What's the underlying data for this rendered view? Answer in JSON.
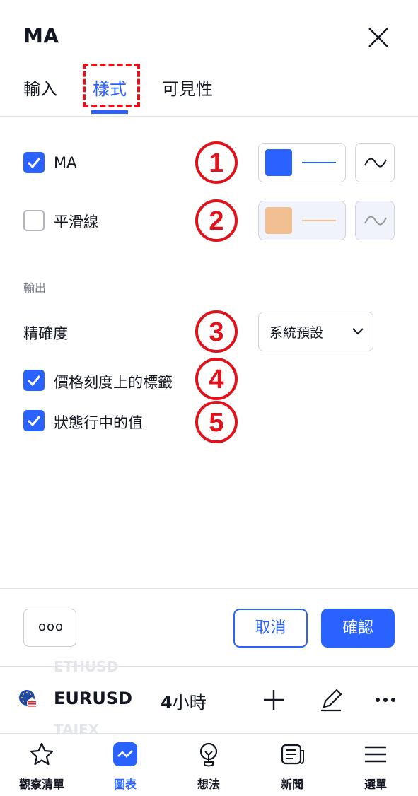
{
  "dialog": {
    "title": "MA",
    "tabs": [
      {
        "label": "輸入",
        "active": false
      },
      {
        "label": "樣式",
        "active": true
      },
      {
        "label": "可見性",
        "active": false
      }
    ]
  },
  "style_rows": [
    {
      "label": "MA",
      "checked": true,
      "color": "#2962ff",
      "callout": "①"
    },
    {
      "label": "平滑線",
      "checked": false,
      "color": "#f1bf92",
      "callout": "②"
    }
  ],
  "output": {
    "section_label": "輸出",
    "precision_label": "精確度",
    "precision_value": "系統預設",
    "precision_callout": "③",
    "price_scale_label": "價格刻度上的標籤",
    "price_scale_checked": true,
    "price_scale_callout": "④",
    "status_line_label": "狀態行中的值",
    "status_line_checked": true,
    "status_line_callout": "⑤"
  },
  "footer": {
    "more_label": "ooo",
    "cancel_label": "取消",
    "ok_label": "確認"
  },
  "toolbar": {
    "ghost_above": "ETHUSD",
    "symbol": "EURUSD",
    "interval_num": "4",
    "interval_unit": "小時",
    "ghost_below": "TAIEX"
  },
  "bottom_nav": [
    {
      "label": "觀察清單",
      "icon": "star-icon",
      "active": false
    },
    {
      "label": "圖表",
      "icon": "chart-icon",
      "active": true
    },
    {
      "label": "想法",
      "icon": "lightbulb-icon",
      "active": false
    },
    {
      "label": "新聞",
      "icon": "news-icon",
      "active": false
    },
    {
      "label": "選單",
      "icon": "menu-icon",
      "active": false
    }
  ],
  "colors": {
    "accent": "#2962ff",
    "callout_red": "#e0121b",
    "smoothing_color": "#f1bf92"
  }
}
